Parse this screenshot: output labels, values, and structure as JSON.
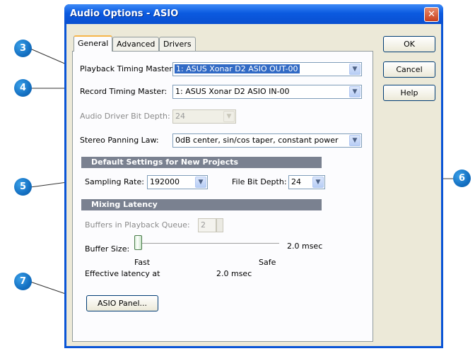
{
  "dialog": {
    "title": "Audio Options - ASIO",
    "close_glyph": "✕"
  },
  "tabs": [
    {
      "label": "General",
      "active": true
    },
    {
      "label": "Advanced",
      "active": false
    },
    {
      "label": "Drivers",
      "active": false
    }
  ],
  "buttons": {
    "ok": "OK",
    "cancel": "Cancel",
    "help": "Help",
    "asio_panel": "ASIO Panel..."
  },
  "general": {
    "playback_label": "Playback Timing Master:",
    "playback_value": "1: ASUS Xonar D2 ASIO OUT-00",
    "record_label": "Record Timing Master:",
    "record_value": "1: ASUS Xonar D2 ASIO IN-00",
    "bitdepth_label": "Audio Driver Bit Depth:",
    "bitdepth_value": "24",
    "panning_label": "Stereo Panning Law:",
    "panning_value": "0dB center, sin/cos taper, constant power"
  },
  "defaults": {
    "header": "Default Settings for New Projects",
    "sampling_label": "Sampling Rate:",
    "sampling_value": "192000",
    "filebit_label": "File Bit Depth:",
    "filebit_value": "24"
  },
  "latency": {
    "header": "Mixing Latency",
    "buffers_label": "Buffers in Playback Queue:",
    "buffers_value": "2",
    "buffer_size_label": "Buffer Size:",
    "buffer_size_value": "2.0 msec",
    "buffer_size_fraction": 0.0,
    "fast_label": "Fast",
    "safe_label": "Safe",
    "effective_label": "Effective latency at",
    "effective_value": "2.0 msec"
  },
  "callouts": [
    "3",
    "4",
    "5",
    "6",
    "7"
  ],
  "colors": {
    "title_bar": "#0b5ae0",
    "callout": "#1470c2",
    "section_bar": "#7a8190",
    "selection": "#316ac5"
  }
}
